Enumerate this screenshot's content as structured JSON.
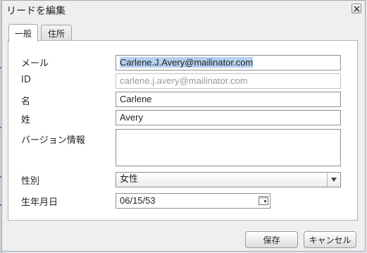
{
  "dialog": {
    "title": "リードを編集"
  },
  "tabs": [
    {
      "label": "一般",
      "active": true
    },
    {
      "label": "住所",
      "active": false
    }
  ],
  "form": {
    "email_label": "メール",
    "email_value": "Carlene.J.Avery@mailinator.com",
    "id_label": "ID",
    "id_value": "carlene.j.avery@mailinator.com",
    "first_name_label": "名",
    "first_name_value": "Carlene",
    "last_name_label": "姓",
    "last_name_value": "Avery",
    "version_label": "バージョン情報",
    "version_value": "",
    "gender_label": "性別",
    "gender_value": "女性",
    "birthdate_label": "生年月日",
    "birthdate_value": "06/15/53"
  },
  "buttons": {
    "save_label": "保存",
    "cancel_label": "キャンセル"
  },
  "icons": {
    "close": "close-icon",
    "dropdown": "chevron-down-icon",
    "calendar": "calendar-icon"
  }
}
